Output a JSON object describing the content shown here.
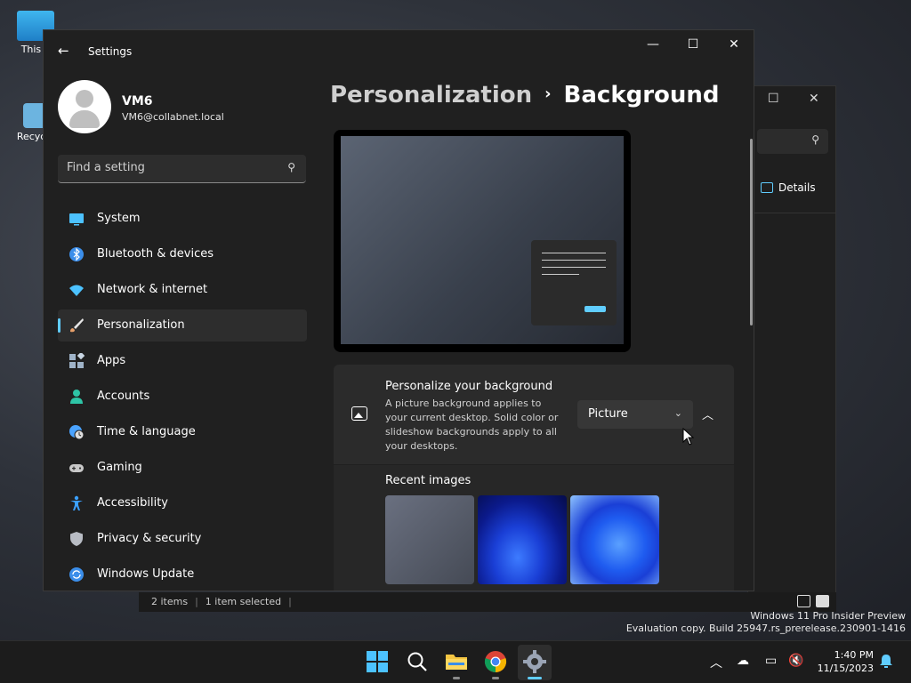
{
  "desktop": {
    "icons": [
      {
        "label": "This P"
      },
      {
        "label": "Recycle"
      }
    ]
  },
  "explorer": {
    "details_label": "Details",
    "status": {
      "items": "2 items",
      "selected": "1 item selected"
    }
  },
  "watermark": {
    "line1": "Windows 11 Pro Insider Preview",
    "line2": "Evaluation copy. Build 25947.rs_prerelease.230901-1416"
  },
  "settings": {
    "title": "Settings",
    "profile": {
      "name": "VM6",
      "email": "VM6@collabnet.local"
    },
    "search": {
      "placeholder": "Find a setting"
    },
    "nav": [
      {
        "label": "System",
        "icon": "monitor-icon",
        "color": "#4cc2ff"
      },
      {
        "label": "Bluetooth & devices",
        "icon": "bluetooth-icon",
        "color": "#3b8eea"
      },
      {
        "label": "Network & internet",
        "icon": "wifi-icon",
        "color": "#4cc2ff"
      },
      {
        "label": "Personalization",
        "icon": "brush-icon",
        "color": "#e8a06a",
        "active": true
      },
      {
        "label": "Apps",
        "icon": "apps-icon",
        "color": "#9fb3c8"
      },
      {
        "label": "Accounts",
        "icon": "person-icon",
        "color": "#2ec4a6"
      },
      {
        "label": "Time & language",
        "icon": "globe-clock-icon",
        "color": "#4aa3ff"
      },
      {
        "label": "Gaming",
        "icon": "gamepad-icon",
        "color": "#c8c8c8"
      },
      {
        "label": "Accessibility",
        "icon": "accessibility-icon",
        "color": "#3ba0ff"
      },
      {
        "label": "Privacy & security",
        "icon": "shield-icon",
        "color": "#b8bcc4"
      },
      {
        "label": "Windows Update",
        "icon": "update-icon",
        "color": "#3b8eea"
      }
    ],
    "breadcrumb": {
      "parent": "Personalization",
      "current": "Background"
    },
    "background_card": {
      "title": "Personalize your background",
      "description": "A picture background applies to your current desktop. Solid color or slideshow backgrounds apply to all your desktops.",
      "selected": "Picture"
    },
    "recent_images": {
      "title": "Recent images"
    }
  },
  "taskbar": {
    "time": "1:40 PM",
    "date": "11/15/2023"
  },
  "colors": {
    "accent": "#60cdff"
  }
}
